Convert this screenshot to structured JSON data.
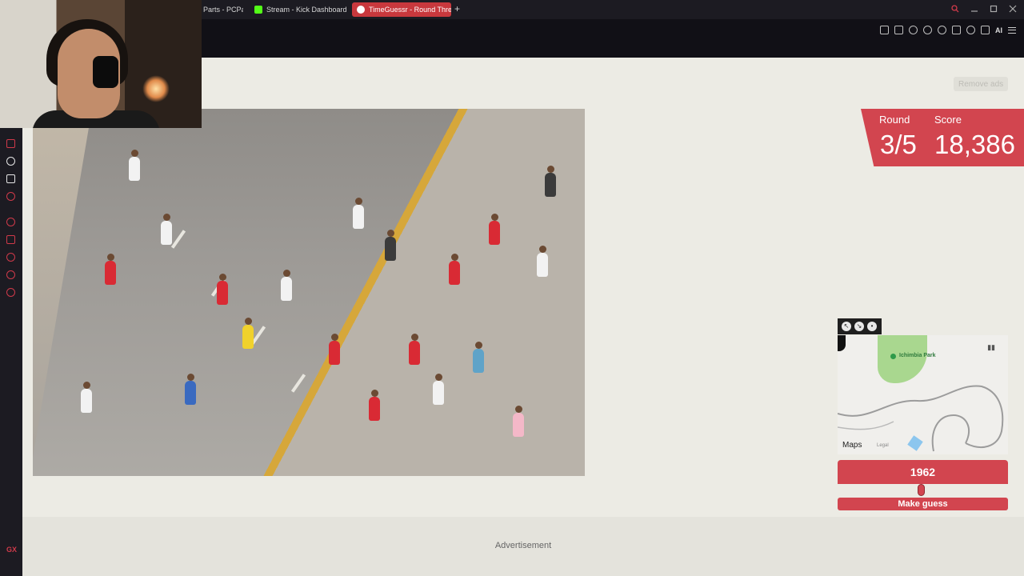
{
  "browser": {
    "tabs": [
      {
        "label": "Parts - PCPa",
        "favicon_color": "#3a3a3a"
      },
      {
        "label": "Stream - Kick Dashboard",
        "favicon_color": "#53fc18"
      },
      {
        "label": "TimeGuessr - Round Three",
        "favicon_color": "#e86b6b"
      }
    ],
    "new_tab": "+",
    "toolbar_ai": "AI"
  },
  "sidebar": {
    "bottom_label": "GX"
  },
  "page": {
    "remove_ads": "Remove ads",
    "round_label": "Round",
    "round_value": "3/5",
    "score_label": "Score",
    "score_value": "18,386",
    "map": {
      "park_label": "Ichimbia Park",
      "brand": "Maps",
      "legal": "Legal"
    },
    "year": "1962",
    "make_guess": "Make guess",
    "advertisement": "Advertisement"
  },
  "colors": {
    "accent": "#d2454f",
    "page_bg": "#ecebe4"
  },
  "icons": [
    "close-icon",
    "search-icon",
    "minimize-icon",
    "maximize-icon",
    "bookmark-icon",
    "heart-icon",
    "extensions-icon",
    "download-icon",
    "menu-icon"
  ]
}
